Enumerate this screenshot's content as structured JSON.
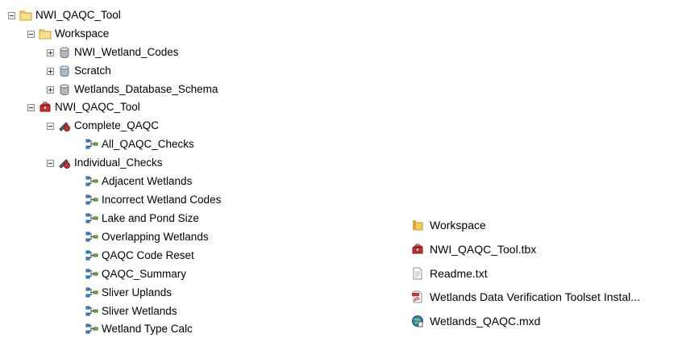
{
  "tree": {
    "root": {
      "label": "NWI_QAQC_Tool",
      "icon": "folder-icon"
    },
    "workspace": {
      "label": "Workspace",
      "icon": "folder-icon"
    },
    "databases": [
      {
        "label": "NWI_Wetland_Codes",
        "icon": "database-icon"
      },
      {
        "label": "Scratch",
        "icon": "database-icon"
      },
      {
        "label": "Wetlands_Database_Schema",
        "icon": "database-icon"
      }
    ],
    "toolbox": {
      "label": "NWI_QAQC_Tool",
      "icon": "toolbox-icon"
    },
    "toolsets": [
      {
        "label": "Complete_QAQC",
        "icon": "toolset-icon",
        "models": [
          {
            "label": "All_QAQC_Checks",
            "icon": "model-icon"
          }
        ]
      },
      {
        "label": "Individual_Checks",
        "icon": "toolset-icon",
        "models": [
          {
            "label": "Adjacent Wetlands",
            "icon": "model-icon"
          },
          {
            "label": "Incorrect Wetland Codes",
            "icon": "model-icon"
          },
          {
            "label": "Lake and Pond Size",
            "icon": "model-icon"
          },
          {
            "label": "Overlapping Wetlands",
            "icon": "model-icon"
          },
          {
            "label": "QAQC Code Reset",
            "icon": "model-icon"
          },
          {
            "label": "QAQC_Summary",
            "icon": "model-icon"
          },
          {
            "label": "Sliver Uplands",
            "icon": "model-icon"
          },
          {
            "label": "Sliver Wetlands",
            "icon": "model-icon"
          },
          {
            "label": "Wetland Type Calc",
            "icon": "model-icon"
          }
        ]
      }
    ]
  },
  "files": [
    {
      "label": "Workspace",
      "icon": "folder-icon"
    },
    {
      "label": "NWI_QAQC_Tool.tbx",
      "icon": "toolbox-icon"
    },
    {
      "label": "Readme.txt",
      "icon": "text-file-icon"
    },
    {
      "label": "Wetlands Data Verification Toolset Instal...",
      "icon": "pdf-icon"
    },
    {
      "label": "Wetlands_QAQC.mxd",
      "icon": "map-document-icon"
    }
  ]
}
